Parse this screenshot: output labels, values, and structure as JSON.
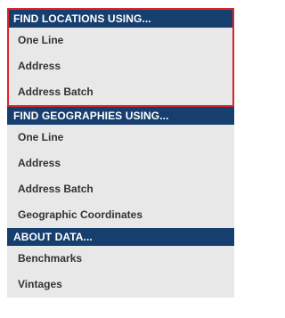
{
  "sections": [
    {
      "header": "FIND LOCATIONS USING...",
      "items": [
        "One Line",
        "Address",
        "Address Batch"
      ]
    },
    {
      "header": "FIND GEOGRAPHIES USING...",
      "items": [
        "One Line",
        "Address",
        "Address Batch",
        "Geographic Coordinates"
      ]
    },
    {
      "header": "ABOUT DATA...",
      "items": [
        "Benchmarks",
        "Vintages"
      ]
    }
  ],
  "colors": {
    "header_bg": "#163e6e",
    "item_bg": "#e8e8e8",
    "highlight_border": "#d9262b"
  }
}
